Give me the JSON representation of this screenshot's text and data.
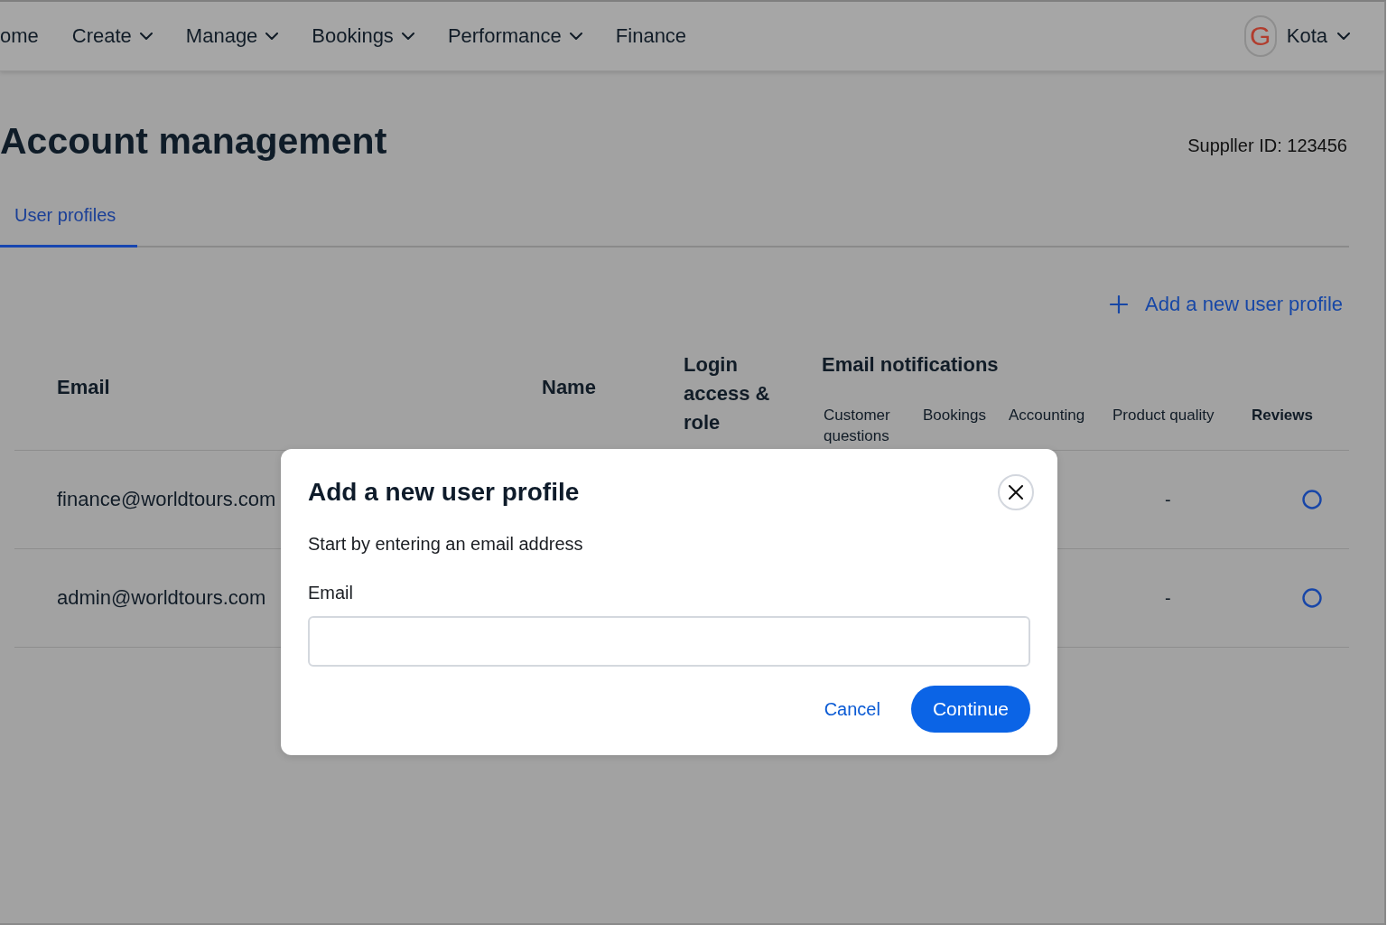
{
  "nav": {
    "items": [
      {
        "label": "ome",
        "dropdown": false
      },
      {
        "label": "Create",
        "dropdown": true
      },
      {
        "label": "Manage",
        "dropdown": true
      },
      {
        "label": "Bookings",
        "dropdown": true
      },
      {
        "label": "Performance",
        "dropdown": true
      },
      {
        "label": "Finance",
        "dropdown": false
      }
    ],
    "user": {
      "initial": "G",
      "name": "Kota"
    }
  },
  "header": {
    "title": "Account management",
    "supplier_id": "Suppller ID: 123456"
  },
  "tabs": [
    {
      "label": "User profiles",
      "selected": true
    }
  ],
  "add_profile_button": {
    "label": "Add a new user profile"
  },
  "table": {
    "columns": [
      "Email",
      "Name",
      "Login access & role"
    ],
    "notifications": {
      "label": "Email notifications",
      "columns": [
        {
          "label": "Customer questions",
          "kind": "text"
        },
        {
          "label": "Bookings",
          "kind": "text"
        },
        {
          "label": "Accounting",
          "kind": "text"
        },
        {
          "label": "Product quality",
          "kind": "text"
        },
        {
          "label": "Reviews",
          "kind": "toggle"
        }
      ]
    },
    "rows": [
      {
        "email": "finance@worldtours.com",
        "product_quality": "-",
        "reviews": {
          "checked": false
        }
      },
      {
        "email": "admin@worldtours.com",
        "product_quality": "-",
        "reviews": {
          "checked": false
        }
      }
    ]
  },
  "dialog": {
    "title": "Add a new user profile",
    "description": "Start by entering an email address",
    "field": {
      "label": "Email"
    },
    "buttons": [
      {
        "label": "Cancel",
        "kind": "link"
      },
      {
        "label": "Continue",
        "kind": "primary"
      }
    ]
  }
}
